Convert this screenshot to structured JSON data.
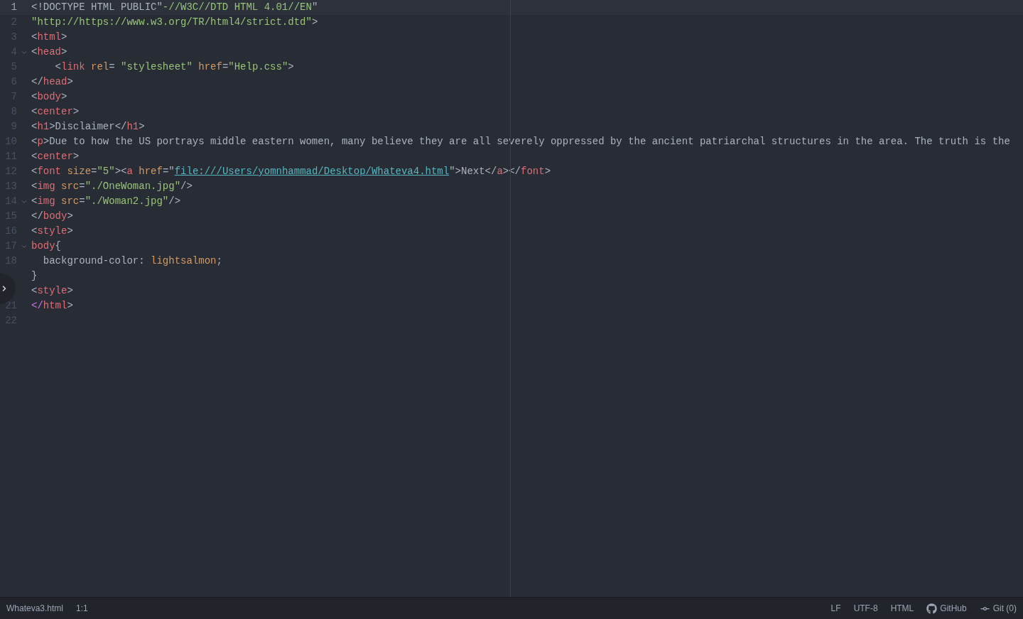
{
  "editor": {
    "lines": [
      {
        "number": "1",
        "current": true,
        "foldable": false,
        "tokens": [
          {
            "text": "<!DOCTYPE HTML PUBLIC\"",
            "kind": "plain"
          },
          {
            "text": "-//W3C//DTD HTML 4.01//EN",
            "kind": "string"
          },
          {
            "text": "\"",
            "kind": "plain"
          }
        ]
      },
      {
        "number": "2",
        "current": false,
        "foldable": false,
        "tokens": [
          {
            "text": "\"http://https://www.w3.org/TR/html4/strict.dtd\"",
            "kind": "string"
          },
          {
            "text": ">",
            "kind": "plain"
          }
        ]
      },
      {
        "number": "3",
        "current": false,
        "foldable": false,
        "tokens": [
          {
            "text": "<",
            "kind": "plain"
          },
          {
            "text": "html",
            "kind": "tag"
          },
          {
            "text": ">",
            "kind": "plain"
          }
        ]
      },
      {
        "number": "4",
        "current": false,
        "foldable": true,
        "tokens": [
          {
            "text": "<",
            "kind": "plain"
          },
          {
            "text": "head",
            "kind": "tag"
          },
          {
            "text": ">",
            "kind": "plain"
          }
        ]
      },
      {
        "number": "5",
        "current": false,
        "foldable": false,
        "tokens": [
          {
            "text": "    <",
            "kind": "plain"
          },
          {
            "text": "link ",
            "kind": "tag"
          },
          {
            "text": "rel",
            "kind": "attr"
          },
          {
            "text": "= ",
            "kind": "plain"
          },
          {
            "text": "\"stylesheet\" ",
            "kind": "string"
          },
          {
            "text": "href",
            "kind": "attr"
          },
          {
            "text": "=",
            "kind": "plain"
          },
          {
            "text": "\"Help.css\"",
            "kind": "string"
          },
          {
            "text": ">",
            "kind": "plain"
          }
        ]
      },
      {
        "number": "6",
        "current": false,
        "foldable": false,
        "tokens": [
          {
            "text": "</",
            "kind": "plain"
          },
          {
            "text": "head",
            "kind": "tag"
          },
          {
            "text": ">",
            "kind": "plain"
          }
        ]
      },
      {
        "number": "7",
        "current": false,
        "foldable": false,
        "tokens": [
          {
            "text": "<",
            "kind": "plain"
          },
          {
            "text": "body",
            "kind": "tag"
          },
          {
            "text": ">",
            "kind": "plain"
          }
        ]
      },
      {
        "number": "8",
        "current": false,
        "foldable": false,
        "tokens": [
          {
            "text": "<",
            "kind": "plain"
          },
          {
            "text": "center",
            "kind": "tag"
          },
          {
            "text": ">",
            "kind": "plain"
          }
        ]
      },
      {
        "number": "9",
        "current": false,
        "foldable": false,
        "tokens": [
          {
            "text": "<",
            "kind": "plain"
          },
          {
            "text": "h1",
            "kind": "tag"
          },
          {
            "text": ">Disclaimer</",
            "kind": "plain"
          },
          {
            "text": "h1",
            "kind": "tag"
          },
          {
            "text": ">",
            "kind": "plain"
          }
        ]
      },
      {
        "number": "10",
        "current": false,
        "foldable": false,
        "tokens": [
          {
            "text": "<",
            "kind": "plain"
          },
          {
            "text": "p",
            "kind": "tag"
          },
          {
            "text": ">Due to how the US portrays middle eastern women, many believe they are all severely oppressed by the ancient patriarchal structures in the area. The truth is the",
            "kind": "plain"
          }
        ]
      },
      {
        "number": "11",
        "current": false,
        "foldable": false,
        "tokens": [
          {
            "text": "<",
            "kind": "plain"
          },
          {
            "text": "center",
            "kind": "tag"
          },
          {
            "text": ">",
            "kind": "plain"
          }
        ]
      },
      {
        "number": "12",
        "current": false,
        "foldable": false,
        "tokens": [
          {
            "text": "<",
            "kind": "plain"
          },
          {
            "text": "font ",
            "kind": "tag"
          },
          {
            "text": "size",
            "kind": "attr"
          },
          {
            "text": "=",
            "kind": "plain"
          },
          {
            "text": "\"5\"",
            "kind": "string"
          },
          {
            "text": "><",
            "kind": "plain"
          },
          {
            "text": "a ",
            "kind": "tag"
          },
          {
            "text": "href",
            "kind": "attr"
          },
          {
            "text": "=\"",
            "kind": "plain"
          },
          {
            "text": "file:///Users/yomnhammad/Desktop/Whateva4.html",
            "kind": "link"
          },
          {
            "text": "\">Next</",
            "kind": "plain"
          },
          {
            "text": "a",
            "kind": "tag"
          },
          {
            "text": "></",
            "kind": "plain"
          },
          {
            "text": "font",
            "kind": "tag"
          },
          {
            "text": ">",
            "kind": "plain"
          }
        ]
      },
      {
        "number": "13",
        "current": false,
        "foldable": false,
        "tokens": [
          {
            "text": "<",
            "kind": "plain"
          },
          {
            "text": "img ",
            "kind": "tag"
          },
          {
            "text": "src",
            "kind": "attr"
          },
          {
            "text": "=",
            "kind": "plain"
          },
          {
            "text": "\"./OneWoman.jpg\"",
            "kind": "string"
          },
          {
            "text": "/>",
            "kind": "plain"
          }
        ]
      },
      {
        "number": "14",
        "current": false,
        "foldable": true,
        "tokens": [
          {
            "text": "<",
            "kind": "plain"
          },
          {
            "text": "img ",
            "kind": "tag"
          },
          {
            "text": "src",
            "kind": "attr"
          },
          {
            "text": "=",
            "kind": "plain"
          },
          {
            "text": "\"./Woman2.jpg\"",
            "kind": "string"
          },
          {
            "text": "/>",
            "kind": "plain"
          }
        ]
      },
      {
        "number": "15",
        "current": false,
        "foldable": false,
        "tokens": [
          {
            "text": "</",
            "kind": "plain"
          },
          {
            "text": "body",
            "kind": "tag"
          },
          {
            "text": ">",
            "kind": "plain"
          }
        ]
      },
      {
        "number": "16",
        "current": false,
        "foldable": false,
        "tokens": [
          {
            "text": "<",
            "kind": "plain"
          },
          {
            "text": "style",
            "kind": "tag"
          },
          {
            "text": ">",
            "kind": "plain"
          }
        ]
      },
      {
        "number": "17",
        "current": false,
        "foldable": true,
        "tokens": [
          {
            "text": "body",
            "kind": "tag"
          },
          {
            "text": "{",
            "kind": "plain"
          }
        ]
      },
      {
        "number": "18",
        "current": false,
        "foldable": false,
        "tokens": [
          {
            "text": "  background-color: ",
            "kind": "plain"
          },
          {
            "text": "lightsalmon",
            "kind": "attr"
          },
          {
            "text": ";",
            "kind": "plain"
          }
        ]
      },
      {
        "current": false,
        "foldable": false,
        "tokens": [
          {
            "text": "}",
            "kind": "plain"
          }
        ]
      },
      {
        "current": false,
        "foldable": false,
        "tokens": [
          {
            "text": "<",
            "kind": "plain"
          },
          {
            "text": "style",
            "kind": "tag"
          },
          {
            "text": ">",
            "kind": "plain"
          }
        ]
      },
      {
        "number": "21",
        "current": false,
        "foldable": false,
        "tokens": [
          {
            "text": "</",
            "kind": "keyword"
          },
          {
            "text": "html",
            "kind": "tag"
          },
          {
            "text": ">",
            "kind": "plain"
          }
        ]
      },
      {
        "number": "22",
        "current": false,
        "foldable": false
      }
    ]
  },
  "status_bar": {
    "left": [
      "Whateva3.html",
      "1:1"
    ],
    "right": [
      {
        "text": "LF",
        "kind": "text"
      },
      {
        "text": "UTF-8",
        "kind": "text"
      },
      {
        "text": "HTML",
        "kind": "text"
      },
      {
        "text": "GitHub",
        "kind": "host"
      },
      {
        "text": "Git (0)",
        "kind": "vcs"
      }
    ]
  }
}
